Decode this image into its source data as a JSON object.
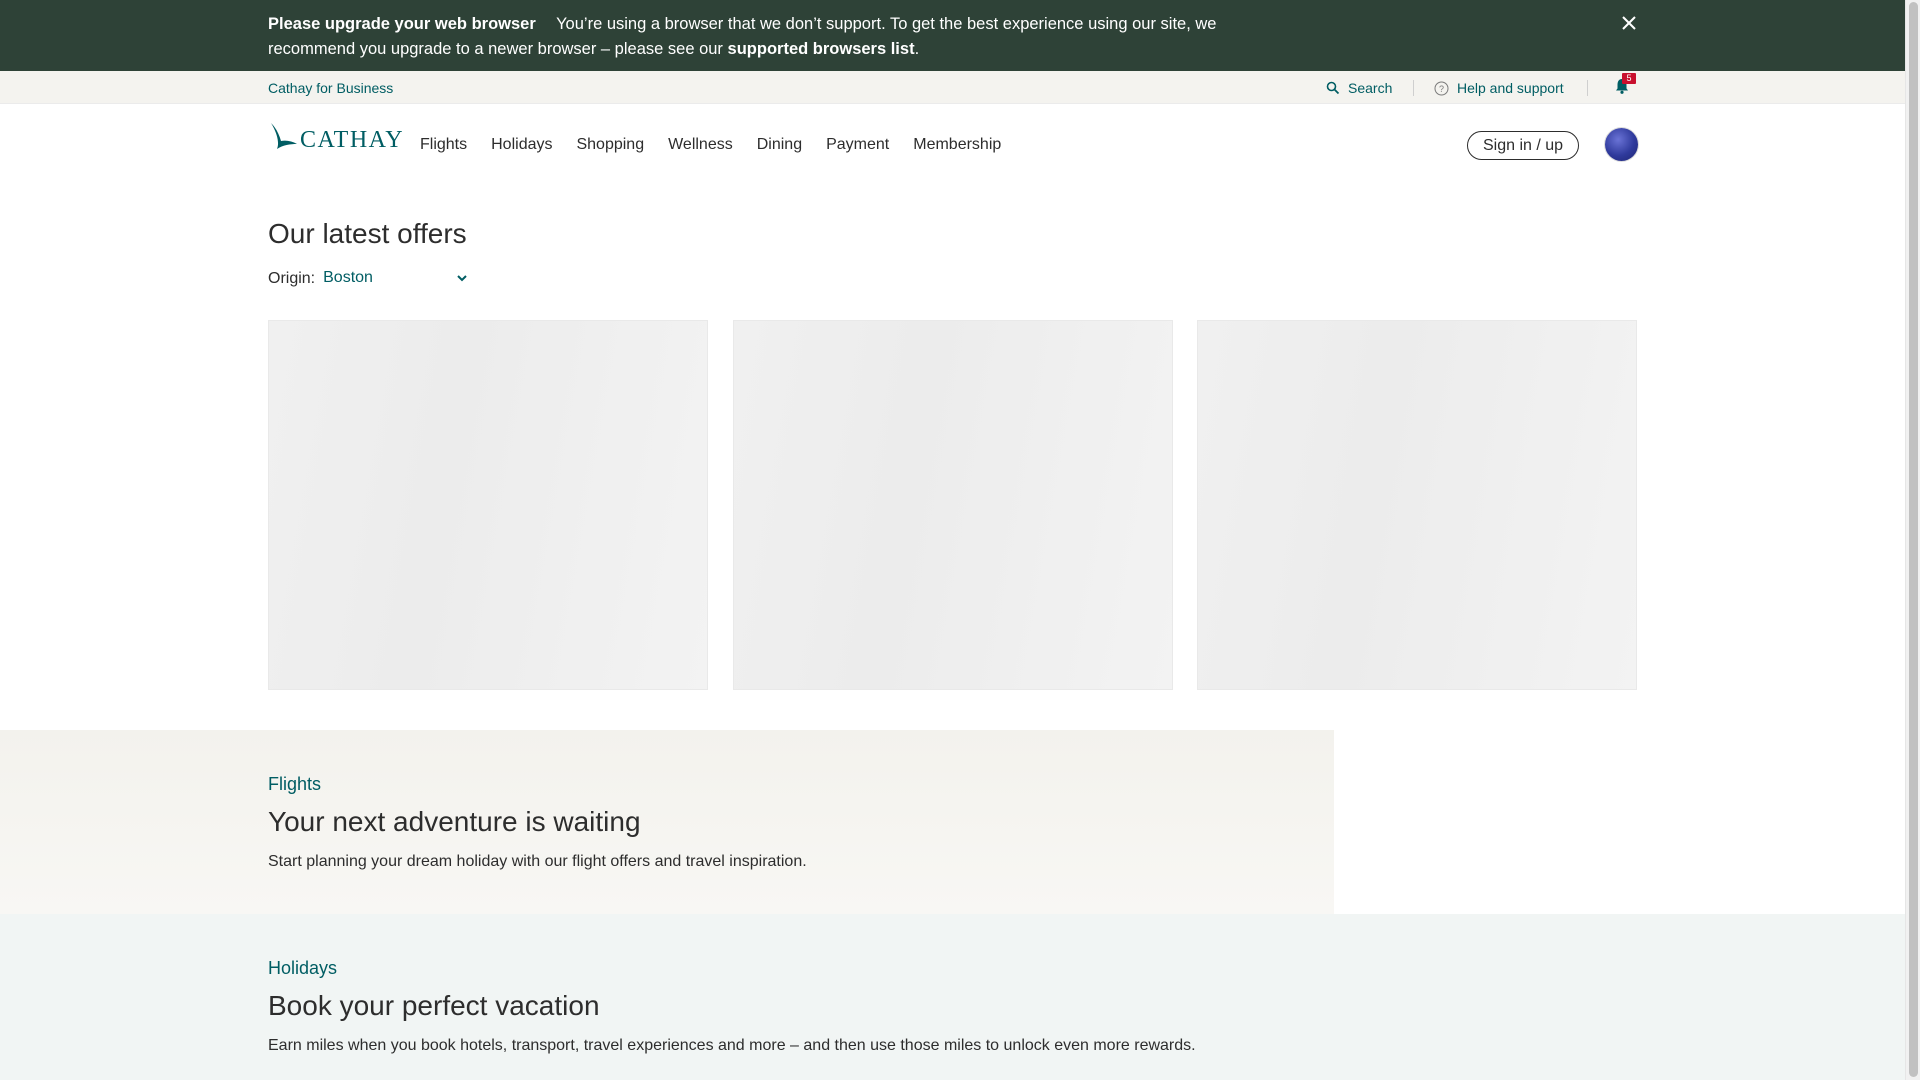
{
  "banner": {
    "title": "Please upgrade your web browser",
    "message": "You’re using a browser that we don’t support. To get the best experience using our site, we recommend you upgrade to a newer browser – please see our",
    "link_label": "supported browsers list",
    "trailing": ".",
    "close_icon": "close-icon"
  },
  "utility": {
    "business_label": "Cathay for Business",
    "search_label": "Search",
    "help_label": "Help and support",
    "notification_count": "5"
  },
  "nav": {
    "brand": "CATHAY",
    "items": [
      "Flights",
      "Holidays",
      "Shopping",
      "Wellness",
      "Dining",
      "Payment",
      "Membership"
    ],
    "signin_label": "Sign in / up"
  },
  "offers": {
    "title": "Our latest offers",
    "origin_label": "Origin:",
    "origin_value": "Boston"
  },
  "sections": {
    "flights": {
      "kicker": "Flights",
      "title": "Your next adventure is waiting",
      "description": "Start planning your dream holiday with our flight offers and travel inspiration."
    },
    "holidays": {
      "kicker": "Holidays",
      "title": "Book your perfect vacation",
      "description": "Earn miles when you book hotels, transport, travel experiences and more – and then use those miles to unlock even more rewards."
    }
  },
  "colors": {
    "brand": "#005d63",
    "banner_bg": "#2e4237",
    "badge": "#c8102e"
  }
}
